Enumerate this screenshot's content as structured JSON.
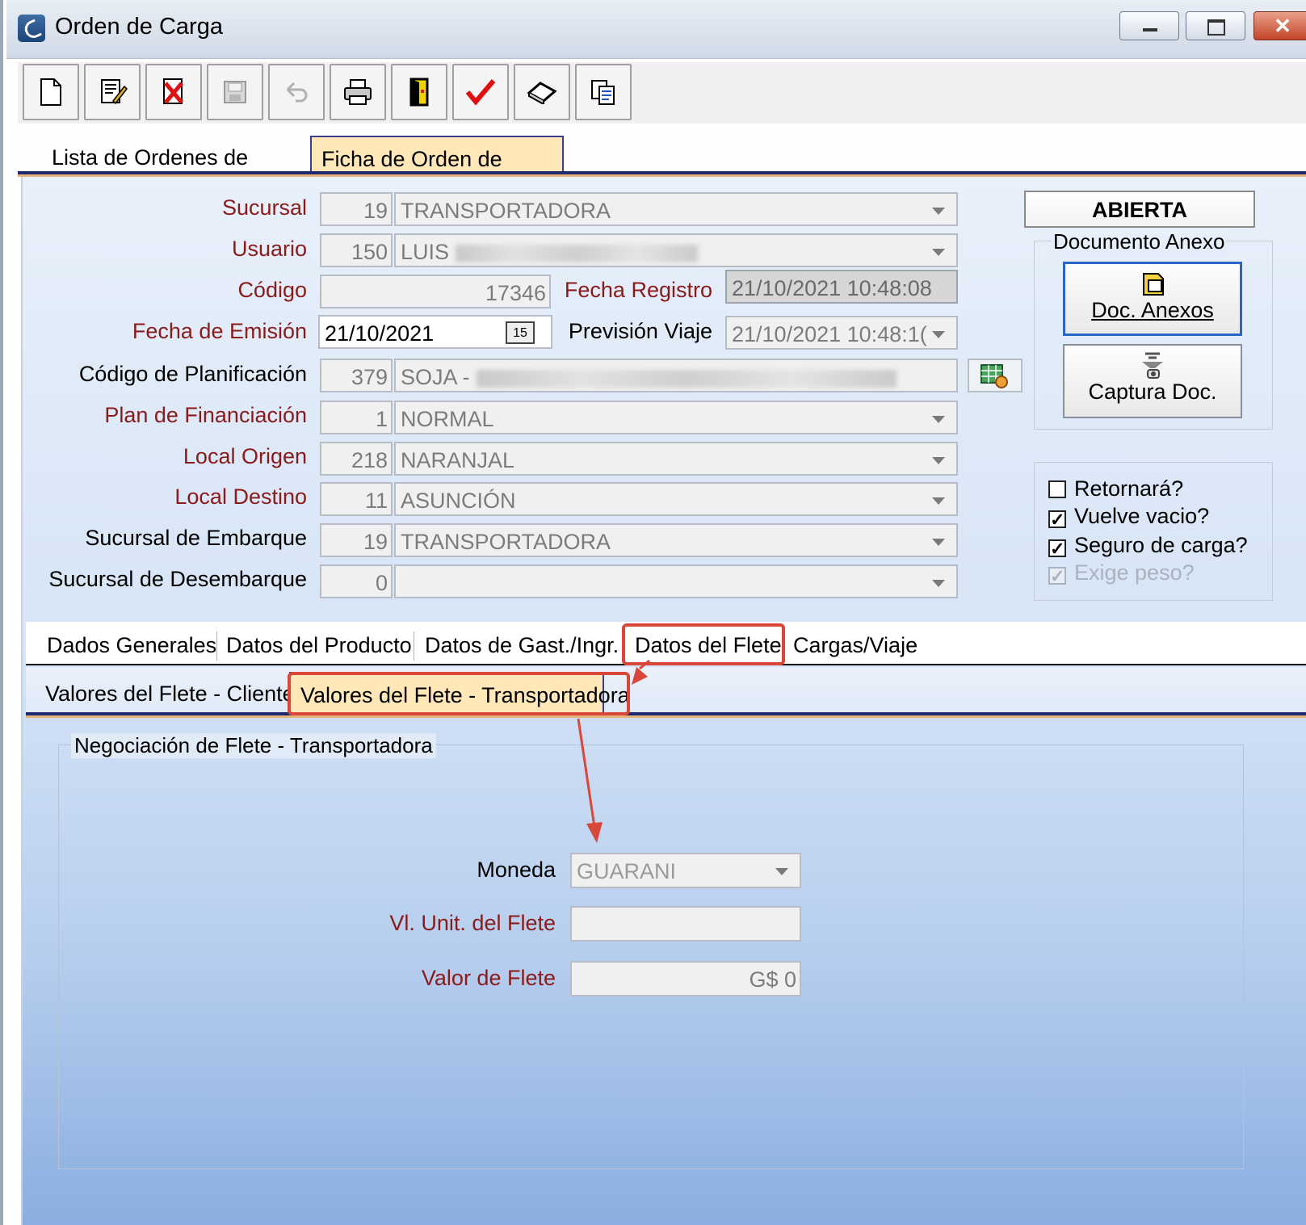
{
  "window": {
    "title": "Orden de Carga"
  },
  "toolbar": {
    "buttons": [
      {
        "name": "new-document",
        "glyph": "🗋",
        "enabled": true
      },
      {
        "name": "edit-document",
        "glyph": "📝",
        "enabled": true
      },
      {
        "name": "delete-document",
        "glyph": "✖",
        "enabled": true
      },
      {
        "name": "save",
        "glyph": "💾",
        "enabled": false
      },
      {
        "name": "undo",
        "glyph": "↶",
        "enabled": false
      },
      {
        "name": "print",
        "glyph": "🖶",
        "enabled": true
      },
      {
        "name": "exit",
        "glyph": "▮",
        "enabled": true
      },
      {
        "name": "confirm",
        "glyph": "✔",
        "enabled": true
      },
      {
        "name": "eraser",
        "glyph": "◇",
        "enabled": true
      },
      {
        "name": "copy",
        "glyph": "⧉",
        "enabled": true
      }
    ]
  },
  "tabs_main": {
    "list": "Lista de Ordenes de Carga",
    "detail": "Ficha de Orden de Carga"
  },
  "form": {
    "sucursal": {
      "label": "Sucursal",
      "code": "19",
      "name": "TRANSPORTADORA"
    },
    "usuario": {
      "label": "Usuario",
      "code": "150",
      "name": "LUIS"
    },
    "codigo": {
      "label": "Código",
      "value": "17346"
    },
    "fecha_registro": {
      "label": "Fecha Registro",
      "value": "21/10/2021 10:48:08"
    },
    "fecha_emision": {
      "label": "Fecha de Emisión",
      "value": "21/10/2021",
      "cal": "15"
    },
    "prevision_viaje": {
      "label": "Previsión Viaje",
      "value": "21/10/2021 10:48:1("
    },
    "codigo_planificacion": {
      "label": "Código de Planificación",
      "code": "379",
      "name": "SOJA -"
    },
    "plan_financiacion": {
      "label": "Plan de Financiación",
      "code": "1",
      "name": "NORMAL"
    },
    "local_origen": {
      "label": "Local Origen",
      "code": "218",
      "name": "NARANJAL"
    },
    "local_destino": {
      "label": "Local Destino",
      "code": "11",
      "name": "ASUNCIÓN"
    },
    "sucursal_embarque": {
      "label": "Sucursal de Embarque",
      "code": "19",
      "name": "TRANSPORTADORA"
    },
    "sucursal_desembarque": {
      "label": "Sucursal de Desembarque",
      "code": "0",
      "name": ""
    }
  },
  "status": "ABIERTA",
  "documento_anexo": {
    "title": "Documento Anexo",
    "doc_anexos": "Doc. Anexos",
    "captura": "Captura Doc."
  },
  "checks": {
    "retornara": {
      "label": "Retornará?",
      "checked": false
    },
    "vuelve_vacio": {
      "label": "Vuelve vacio?",
      "checked": true
    },
    "seguro_carga": {
      "label": "Seguro de carga?",
      "checked": true
    },
    "exige_peso": {
      "label": "Exige peso?",
      "checked": true,
      "enabled": false
    }
  },
  "tabs_sub": [
    "Dados Generales",
    "Datos del Producto",
    "Datos de Gast./Ingr.",
    "Datos del Flete",
    "Cargas/Viaje"
  ],
  "tabs_flete": {
    "cliente": "Valores del Flete - Cliente",
    "transportadora": "Valores del Flete - Transportadora"
  },
  "negociacion": {
    "title": "Negociación de Flete - Transportadora",
    "moneda": {
      "label": "Moneda",
      "value": "GUARANI"
    },
    "vl_unit": {
      "label": "Vl. Unit. del Flete",
      "value": ""
    },
    "valor_flete": {
      "label": "Valor de Flete",
      "value": "G$ 0"
    }
  },
  "colors": {
    "required_label": "#8b1a1a",
    "highlight": "#d9463a",
    "tab_active": "#ffe7b8"
  }
}
